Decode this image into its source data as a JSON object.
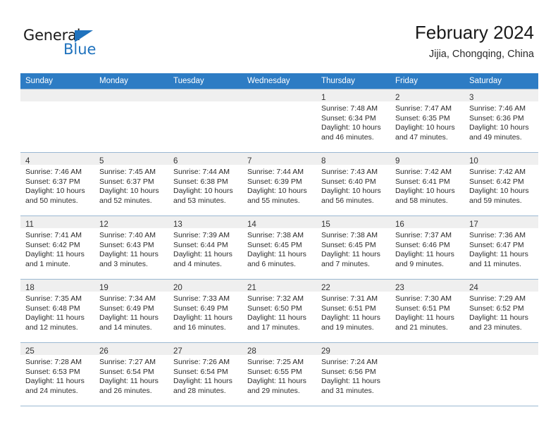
{
  "brand": {
    "name_part1": "General",
    "name_part2": "Blue"
  },
  "header": {
    "title": "February 2024",
    "subtitle": "Jijia, Chongqing, China"
  },
  "colors": {
    "header_blue": "#2d7cc4",
    "brand_blue": "#1f72bd",
    "daynum_strip": "#efefef",
    "grid_line": "#9bb8d2"
  },
  "weekdays": [
    "Sunday",
    "Monday",
    "Tuesday",
    "Wednesday",
    "Thursday",
    "Friday",
    "Saturday"
  ],
  "weeks": [
    [
      {
        "day": ""
      },
      {
        "day": ""
      },
      {
        "day": ""
      },
      {
        "day": ""
      },
      {
        "day": "1",
        "sunrise": "Sunrise: 7:48 AM",
        "sunset": "Sunset: 6:34 PM",
        "daylight_line1": "Daylight: 10 hours",
        "daylight_line2": "and 46 minutes."
      },
      {
        "day": "2",
        "sunrise": "Sunrise: 7:47 AM",
        "sunset": "Sunset: 6:35 PM",
        "daylight_line1": "Daylight: 10 hours",
        "daylight_line2": "and 47 minutes."
      },
      {
        "day": "3",
        "sunrise": "Sunrise: 7:46 AM",
        "sunset": "Sunset: 6:36 PM",
        "daylight_line1": "Daylight: 10 hours",
        "daylight_line2": "and 49 minutes."
      }
    ],
    [
      {
        "day": "4",
        "sunrise": "Sunrise: 7:46 AM",
        "sunset": "Sunset: 6:37 PM",
        "daylight_line1": "Daylight: 10 hours",
        "daylight_line2": "and 50 minutes."
      },
      {
        "day": "5",
        "sunrise": "Sunrise: 7:45 AM",
        "sunset": "Sunset: 6:37 PM",
        "daylight_line1": "Daylight: 10 hours",
        "daylight_line2": "and 52 minutes."
      },
      {
        "day": "6",
        "sunrise": "Sunrise: 7:44 AM",
        "sunset": "Sunset: 6:38 PM",
        "daylight_line1": "Daylight: 10 hours",
        "daylight_line2": "and 53 minutes."
      },
      {
        "day": "7",
        "sunrise": "Sunrise: 7:44 AM",
        "sunset": "Sunset: 6:39 PM",
        "daylight_line1": "Daylight: 10 hours",
        "daylight_line2": "and 55 minutes."
      },
      {
        "day": "8",
        "sunrise": "Sunrise: 7:43 AM",
        "sunset": "Sunset: 6:40 PM",
        "daylight_line1": "Daylight: 10 hours",
        "daylight_line2": "and 56 minutes."
      },
      {
        "day": "9",
        "sunrise": "Sunrise: 7:42 AM",
        "sunset": "Sunset: 6:41 PM",
        "daylight_line1": "Daylight: 10 hours",
        "daylight_line2": "and 58 minutes."
      },
      {
        "day": "10",
        "sunrise": "Sunrise: 7:42 AM",
        "sunset": "Sunset: 6:42 PM",
        "daylight_line1": "Daylight: 10 hours",
        "daylight_line2": "and 59 minutes."
      }
    ],
    [
      {
        "day": "11",
        "sunrise": "Sunrise: 7:41 AM",
        "sunset": "Sunset: 6:42 PM",
        "daylight_line1": "Daylight: 11 hours",
        "daylight_line2": "and 1 minute."
      },
      {
        "day": "12",
        "sunrise": "Sunrise: 7:40 AM",
        "sunset": "Sunset: 6:43 PM",
        "daylight_line1": "Daylight: 11 hours",
        "daylight_line2": "and 3 minutes."
      },
      {
        "day": "13",
        "sunrise": "Sunrise: 7:39 AM",
        "sunset": "Sunset: 6:44 PM",
        "daylight_line1": "Daylight: 11 hours",
        "daylight_line2": "and 4 minutes."
      },
      {
        "day": "14",
        "sunrise": "Sunrise: 7:38 AM",
        "sunset": "Sunset: 6:45 PM",
        "daylight_line1": "Daylight: 11 hours",
        "daylight_line2": "and 6 minutes."
      },
      {
        "day": "15",
        "sunrise": "Sunrise: 7:38 AM",
        "sunset": "Sunset: 6:45 PM",
        "daylight_line1": "Daylight: 11 hours",
        "daylight_line2": "and 7 minutes."
      },
      {
        "day": "16",
        "sunrise": "Sunrise: 7:37 AM",
        "sunset": "Sunset: 6:46 PM",
        "daylight_line1": "Daylight: 11 hours",
        "daylight_line2": "and 9 minutes."
      },
      {
        "day": "17",
        "sunrise": "Sunrise: 7:36 AM",
        "sunset": "Sunset: 6:47 PM",
        "daylight_line1": "Daylight: 11 hours",
        "daylight_line2": "and 11 minutes."
      }
    ],
    [
      {
        "day": "18",
        "sunrise": "Sunrise: 7:35 AM",
        "sunset": "Sunset: 6:48 PM",
        "daylight_line1": "Daylight: 11 hours",
        "daylight_line2": "and 12 minutes."
      },
      {
        "day": "19",
        "sunrise": "Sunrise: 7:34 AM",
        "sunset": "Sunset: 6:49 PM",
        "daylight_line1": "Daylight: 11 hours",
        "daylight_line2": "and 14 minutes."
      },
      {
        "day": "20",
        "sunrise": "Sunrise: 7:33 AM",
        "sunset": "Sunset: 6:49 PM",
        "daylight_line1": "Daylight: 11 hours",
        "daylight_line2": "and 16 minutes."
      },
      {
        "day": "21",
        "sunrise": "Sunrise: 7:32 AM",
        "sunset": "Sunset: 6:50 PM",
        "daylight_line1": "Daylight: 11 hours",
        "daylight_line2": "and 17 minutes."
      },
      {
        "day": "22",
        "sunrise": "Sunrise: 7:31 AM",
        "sunset": "Sunset: 6:51 PM",
        "daylight_line1": "Daylight: 11 hours",
        "daylight_line2": "and 19 minutes."
      },
      {
        "day": "23",
        "sunrise": "Sunrise: 7:30 AM",
        "sunset": "Sunset: 6:51 PM",
        "daylight_line1": "Daylight: 11 hours",
        "daylight_line2": "and 21 minutes."
      },
      {
        "day": "24",
        "sunrise": "Sunrise: 7:29 AM",
        "sunset": "Sunset: 6:52 PM",
        "daylight_line1": "Daylight: 11 hours",
        "daylight_line2": "and 23 minutes."
      }
    ],
    [
      {
        "day": "25",
        "sunrise": "Sunrise: 7:28 AM",
        "sunset": "Sunset: 6:53 PM",
        "daylight_line1": "Daylight: 11 hours",
        "daylight_line2": "and 24 minutes."
      },
      {
        "day": "26",
        "sunrise": "Sunrise: 7:27 AM",
        "sunset": "Sunset: 6:54 PM",
        "daylight_line1": "Daylight: 11 hours",
        "daylight_line2": "and 26 minutes."
      },
      {
        "day": "27",
        "sunrise": "Sunrise: 7:26 AM",
        "sunset": "Sunset: 6:54 PM",
        "daylight_line1": "Daylight: 11 hours",
        "daylight_line2": "and 28 minutes."
      },
      {
        "day": "28",
        "sunrise": "Sunrise: 7:25 AM",
        "sunset": "Sunset: 6:55 PM",
        "daylight_line1": "Daylight: 11 hours",
        "daylight_line2": "and 29 minutes."
      },
      {
        "day": "29",
        "sunrise": "Sunrise: 7:24 AM",
        "sunset": "Sunset: 6:56 PM",
        "daylight_line1": "Daylight: 11 hours",
        "daylight_line2": "and 31 minutes."
      },
      {
        "day": ""
      },
      {
        "day": ""
      }
    ]
  ]
}
